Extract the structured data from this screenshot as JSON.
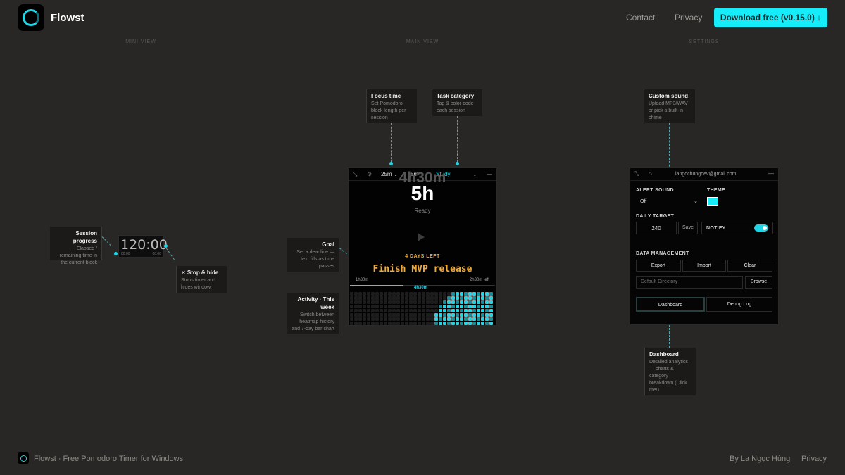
{
  "header": {
    "brand": "Flowst",
    "nav": [
      "Contact",
      "Privacy"
    ],
    "download_label": "Download free (v0.15.0) ↓"
  },
  "sections": [
    "MINI VIEW",
    "MAIN VIEW",
    "SETTINGS"
  ],
  "mini_view": {
    "clock": "120:00",
    "left_small": "00:00",
    "right_small": "00:00",
    "notes": {
      "session_progress": {
        "title": "Session progress",
        "desc": "Elapsed / remaining time in the current block"
      },
      "stop_hide": {
        "title": "✕ Stop & hide",
        "desc": "Stops timer and hides window"
      }
    }
  },
  "main_view": {
    "toolbar": {
      "focus": "25m",
      "break": "5m",
      "category": "Study"
    },
    "ghost_time": "4h30m",
    "time": "5h",
    "status": "Ready",
    "days_left": "4 DAYS LEFT",
    "goal": "Finish MVP release",
    "progress_done": "1h30m",
    "progress_now": "4h30m",
    "progress_left": "2h30m left",
    "notes": {
      "focus_time": {
        "title": "Focus time",
        "desc": "Set Pomodoro block length per session"
      },
      "task_category": {
        "title": "Task category",
        "desc": "Tag & color-code each session"
      },
      "goal": {
        "title": "Goal",
        "desc": "Set a deadline — text fills as time passes"
      },
      "activity": {
        "title": "Activity · This week",
        "desc": "Switch between heatmap history and 7-day bar chart"
      }
    },
    "heatmap_rows": [
      [
        0,
        0,
        0,
        0,
        0,
        0,
        0,
        0,
        0,
        0,
        0,
        0,
        0,
        0,
        0,
        0,
        0,
        0,
        0,
        0,
        0,
        0,
        0,
        0,
        1,
        1,
        1,
        1,
        1,
        1,
        1,
        1,
        1,
        1
      ],
      [
        0,
        0,
        0,
        0,
        0,
        0,
        0,
        0,
        0,
        0,
        0,
        0,
        0,
        0,
        0,
        0,
        0,
        0,
        0,
        0,
        0,
        0,
        0,
        1,
        1,
        1,
        1,
        1,
        1,
        1,
        1,
        1,
        1,
        1
      ],
      [
        0,
        0,
        0,
        0,
        0,
        0,
        0,
        0,
        0,
        0,
        0,
        0,
        0,
        0,
        0,
        0,
        0,
        0,
        0,
        0,
        0,
        0,
        1,
        1,
        1,
        1,
        1,
        1,
        1,
        1,
        1,
        1,
        1,
        1
      ],
      [
        0,
        0,
        0,
        0,
        0,
        0,
        0,
        0,
        0,
        0,
        0,
        0,
        0,
        0,
        0,
        0,
        0,
        0,
        0,
        0,
        0,
        1,
        1,
        1,
        1,
        1,
        1,
        1,
        1,
        1,
        1,
        1,
        1,
        1
      ],
      [
        0,
        0,
        0,
        0,
        0,
        0,
        0,
        0,
        0,
        0,
        0,
        0,
        0,
        0,
        0,
        0,
        0,
        0,
        0,
        0,
        0,
        1,
        1,
        1,
        1,
        1,
        1,
        1,
        1,
        1,
        1,
        1,
        1,
        1
      ],
      [
        0,
        0,
        0,
        0,
        0,
        0,
        0,
        0,
        0,
        0,
        0,
        0,
        0,
        0,
        0,
        0,
        0,
        0,
        0,
        0,
        1,
        1,
        1,
        1,
        1,
        1,
        1,
        1,
        1,
        1,
        1,
        1,
        1,
        1
      ],
      [
        0,
        0,
        0,
        0,
        0,
        0,
        0,
        0,
        0,
        0,
        0,
        0,
        0,
        0,
        0,
        0,
        0,
        0,
        0,
        0,
        1,
        1,
        1,
        1,
        1,
        1,
        1,
        1,
        1,
        1,
        1,
        1,
        1,
        1
      ],
      [
        0,
        0,
        0,
        0,
        0,
        0,
        0,
        0,
        0,
        0,
        0,
        0,
        0,
        0,
        0,
        0,
        0,
        0,
        0,
        0,
        1,
        1,
        1,
        1,
        1,
        1,
        1,
        1,
        1,
        1,
        1,
        1,
        1,
        1
      ]
    ]
  },
  "settings": {
    "email": "langochungdev@gmail.com",
    "alert_sound_label": "ALERT SOUND",
    "alert_sound_value": "Off",
    "theme_label": "THEME",
    "theme_color": "#15eefa",
    "daily_target_label": "DAILY TARGET",
    "daily_target_value": "240",
    "save_label": "Save",
    "notify_label": "NOTIFY",
    "data_mgmt_label": "DATA MANAGEMENT",
    "export_label": "Export",
    "import_label": "Import",
    "clear_label": "Clear",
    "dir_placeholder": "Default Directory",
    "browse_label": "Browse",
    "dashboard_label": "Dashboard",
    "debug_label": "Debug Log",
    "notes": {
      "custom_sound": {
        "title": "Custom sound",
        "desc": "Upload MP3/WAV or pick a built-in chime"
      },
      "dashboard": {
        "title": "Dashboard",
        "desc": "Detailed analytics — charts & category breakdown (Click me!)"
      }
    }
  },
  "footer": {
    "tagline": "Flowst · Free Pomodoro Timer for Windows",
    "author": "By La Ngọc Hùng",
    "privacy": "Privacy"
  },
  "colors": {
    "accent": "#15eefa",
    "goal": "#f2a93b",
    "bg": "#292725"
  }
}
